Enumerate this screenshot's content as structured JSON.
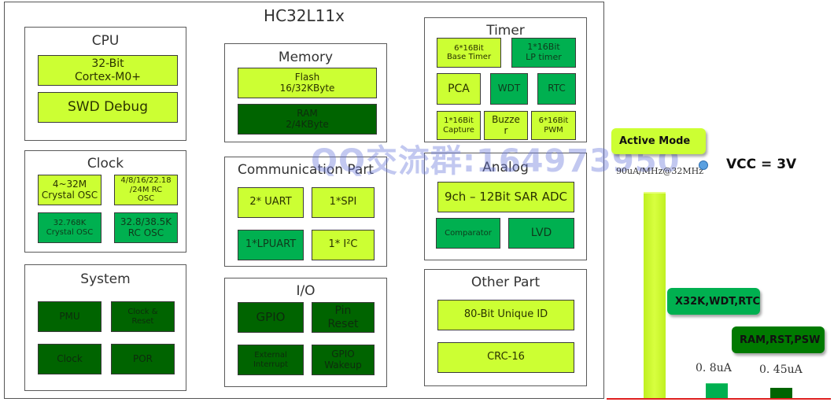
{
  "title": "HC32L11x",
  "watermark": "QQ交流群:164973950",
  "colors": {
    "lime": "#ccff33",
    "mid_green": "#00b050",
    "dark_green": "#006400",
    "baseline": "#e02020",
    "dot": "#5aa0e0"
  },
  "groups": {
    "cpu": {
      "title": "CPU",
      "blocks": [
        "32-Bit\nCortex-M0+",
        "SWD Debug"
      ]
    },
    "clock": {
      "title": "Clock",
      "blocks": [
        "4~32M\nCrystal OSC",
        "4/8/16/22.18\n/24M RC\nOSC",
        "32.768K\nCrystal OSC",
        "32.8/38.5K\nRC OSC"
      ]
    },
    "system": {
      "title": "System",
      "blocks": [
        "PMU",
        "Clock &\nReset",
        "Clock",
        "POR"
      ]
    },
    "memory": {
      "title": "Memory",
      "blocks": [
        "Flash\n16/32KByte",
        "RAM\n2/4KByte"
      ]
    },
    "comm": {
      "title": "Communication Part",
      "blocks": [
        "2* UART",
        "1*SPI",
        "1*LPUART",
        "1* I²C"
      ]
    },
    "io": {
      "title": "I/O",
      "blocks": [
        "GPIO",
        "Pin\nReset",
        "External\nInterrupt",
        "GPIO\nWakeup"
      ]
    },
    "timer": {
      "title": "Timer",
      "blocks": [
        "6*16Bit\nBase Timer",
        "1*16Bit\nLP timer",
        "PCA",
        "WDT",
        "RTC",
        "1*16Bit\nCapture",
        "Buzze\nr",
        "6*16Bit\nPWM"
      ]
    },
    "analog": {
      "title": "Analog",
      "blocks": [
        "9ch – 12Bit SAR ADC",
        "Comparator",
        "LVD"
      ]
    },
    "other": {
      "title": "Other Part",
      "blocks": [
        "80-Bit Unique ID",
        "CRC-16"
      ]
    }
  },
  "power": {
    "vcc_label": "VCC = 3V",
    "modes": [
      {
        "name": "Active Mode",
        "value_label": "90uA/MHz@32MHz"
      },
      {
        "name": "X32K,WDT,RTC",
        "value_label": "0. 8uA"
      },
      {
        "name": "RAM,RST,PSW",
        "value_label": "0. 45uA"
      }
    ]
  }
}
